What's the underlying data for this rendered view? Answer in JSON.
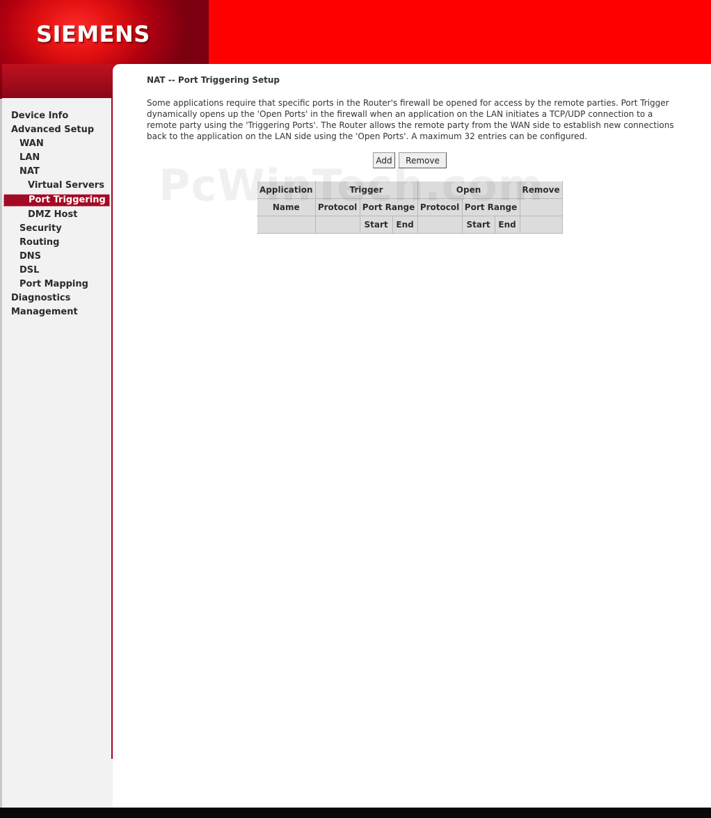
{
  "brand": {
    "logo_text": "SIEMENS"
  },
  "colors": {
    "header_red": "#ff0000",
    "active_nav": "#a30a24",
    "sidebar_bg": "#f2f2f2"
  },
  "sidebar": {
    "items": [
      {
        "label": "Device Info",
        "level": 0,
        "active": false
      },
      {
        "label": "Advanced Setup",
        "level": 0,
        "active": false
      },
      {
        "label": "WAN",
        "level": 1,
        "active": false
      },
      {
        "label": "LAN",
        "level": 1,
        "active": false
      },
      {
        "label": "NAT",
        "level": 1,
        "active": false
      },
      {
        "label": "Virtual Servers",
        "level": 2,
        "active": false
      },
      {
        "label": "Port Triggering",
        "level": 2,
        "active": true
      },
      {
        "label": "DMZ Host",
        "level": 2,
        "active": false
      },
      {
        "label": "Security",
        "level": 1,
        "active": false
      },
      {
        "label": "Routing",
        "level": 1,
        "active": false
      },
      {
        "label": "DNS",
        "level": 1,
        "active": false
      },
      {
        "label": "DSL",
        "level": 1,
        "active": false
      },
      {
        "label": "Port Mapping",
        "level": 1,
        "active": false
      },
      {
        "label": "Diagnostics",
        "level": 0,
        "active": false
      },
      {
        "label": "Management",
        "level": 0,
        "active": false
      }
    ]
  },
  "main": {
    "title": "NAT -- Port Triggering Setup",
    "description": "Some applications require that specific ports in the Router's firewall be opened for access by the remote parties. Port Trigger dynamically opens up the 'Open Ports' in the firewall when an application on the LAN initiates a TCP/UDP connection to a remote party using the 'Triggering Ports'. The Router allows the remote party from the WAN side to establish new connections back to the application on the LAN side using the 'Open Ports'. A maximum 32 entries can be configured.",
    "buttons": {
      "add": "Add",
      "remove": "Remove"
    },
    "watermark": "PcWinTech.com",
    "table": {
      "header_row1": {
        "application": "Application",
        "trigger": "Trigger",
        "open": "Open",
        "remove": "Remove"
      },
      "header_row2": {
        "name": "Name",
        "trigger_protocol": "Protocol",
        "trigger_port_range": "Port Range",
        "open_protocol": "Protocol",
        "open_port_range": "Port Range"
      },
      "header_row3": {
        "trigger_start": "Start",
        "trigger_end": "End",
        "open_start": "Start",
        "open_end": "End"
      },
      "rows": []
    }
  }
}
